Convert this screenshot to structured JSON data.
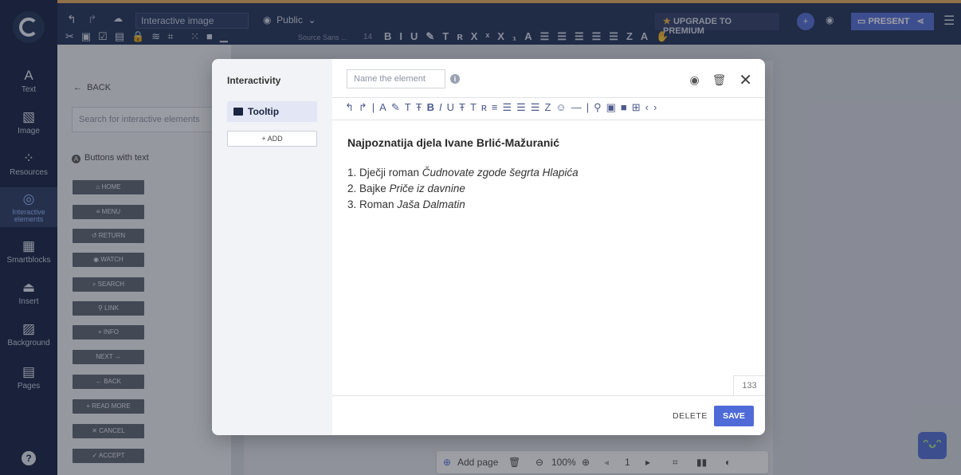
{
  "topbar": {
    "title_placeholder": "Interactive image",
    "visibility": "Public",
    "upgrade_label": "UPGRADE TO PREMIUM",
    "present_label": "PRESENT",
    "font_name": "Source Sans ...",
    "font_size": "14",
    "accent_color": "#4f6bd8",
    "topline_color": "#e8a95a"
  },
  "leftnav": {
    "items": [
      {
        "label": "Text",
        "icon": "text-icon"
      },
      {
        "label": "Image",
        "icon": "image-icon"
      },
      {
        "label": "Resources",
        "icon": "resources-icon"
      },
      {
        "label": "Interactive elements",
        "icon": "interactive-icon"
      },
      {
        "label": "Smartblocks",
        "icon": "smartblocks-icon"
      },
      {
        "label": "Insert",
        "icon": "insert-icon"
      },
      {
        "label": "Background",
        "icon": "background-icon"
      },
      {
        "label": "Pages",
        "icon": "pages-icon"
      }
    ]
  },
  "sidepanel": {
    "back_label": "BACK",
    "search_placeholder": "Search for interactive elements",
    "section_title": "Buttons with text",
    "buttons": [
      "HOME",
      "MENU",
      "RETURN",
      "WATCH",
      "SEARCH",
      "LINK",
      "+ INFO",
      "NEXT →",
      "← BACK",
      "+ READ MORE",
      "✕ CANCEL",
      "✓ ACCEPT"
    ]
  },
  "modal": {
    "title": "Interactivity",
    "tab_label": "Tooltip",
    "add_label": "+ ADD",
    "name_placeholder": "Name the element",
    "heading": "Najpoznatija djela Ivane Brlić-Mažuranić",
    "list": [
      {
        "prefix": "1. Dječji roman ",
        "italic": "Čudnovate zgode šegrta Hlapića"
      },
      {
        "prefix": "2. Bajke ",
        "italic": "Priče iz davnine"
      },
      {
        "prefix": "3. Roman ",
        "italic": "Jaša Dalmatin"
      }
    ],
    "char_count": "133",
    "delete_label": "DELETE",
    "save_label": "SAVE"
  },
  "bottombar": {
    "add_page_label": "Add page",
    "zoom": "100%",
    "page_number": "1"
  }
}
